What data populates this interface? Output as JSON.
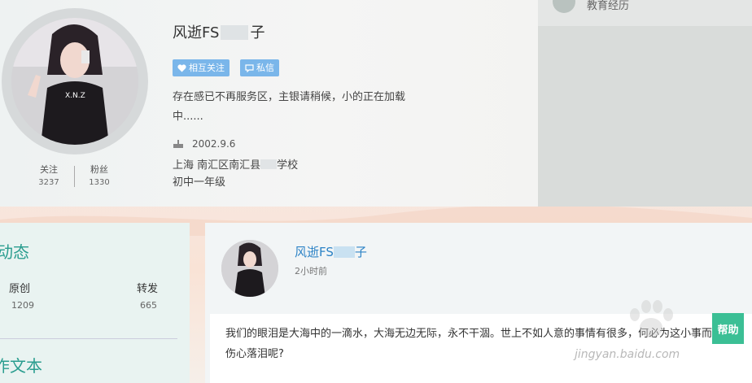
{
  "profile": {
    "username_prefix": "风逝FS",
    "username_suffix": "子",
    "follow_button": "相互关注",
    "message_button": "私信",
    "bio": "存在感已不再服务区，主银请稍候，小的正在加载中......",
    "birthday": "2002.9.6",
    "location_prefix": "上海  南汇区南汇县",
    "location_suffix": "学校",
    "grade": "初中一年级",
    "stats": [
      {
        "label": "关注",
        "value": "3237"
      },
      {
        "label": "粉丝",
        "value": "1330"
      }
    ]
  },
  "sidebar_right": {
    "label": "教育经历"
  },
  "dynamics": {
    "title": "动态",
    "stats": [
      {
        "label": "原创",
        "value": "1209"
      },
      {
        "label": "转发",
        "value": "665"
      }
    ],
    "subtitle": "作文本"
  },
  "post": {
    "username_prefix": "风逝FS",
    "username_suffix": "子",
    "time": "2小时前",
    "text": "我们的眼泪是大海中的一滴水，大海无边无际，永不干涸。世上不如人意的事情有很多，何必为这小事而伤心落泪呢?"
  },
  "help_button": "帮助",
  "watermark": "jingyan.baidu.com",
  "colors": {
    "accent_blue": "#7ab6ea",
    "accent_green": "#2a9d8f",
    "help_green": "#3bbf95",
    "link_blue": "#2d83c6"
  }
}
